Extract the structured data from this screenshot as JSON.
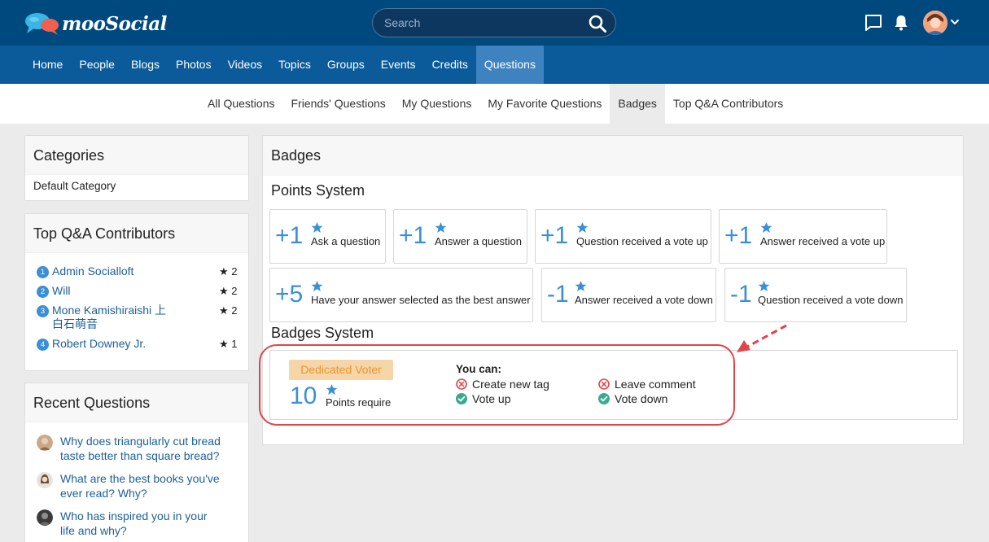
{
  "header": {
    "brand": "mooSocial",
    "search_placeholder": "Search"
  },
  "main_nav": [
    {
      "label": "Home",
      "name": "nav-home"
    },
    {
      "label": "People",
      "name": "nav-people"
    },
    {
      "label": "Blogs",
      "name": "nav-blogs"
    },
    {
      "label": "Photos",
      "name": "nav-photos"
    },
    {
      "label": "Videos",
      "name": "nav-videos"
    },
    {
      "label": "Topics",
      "name": "nav-topics"
    },
    {
      "label": "Groups",
      "name": "nav-groups"
    },
    {
      "label": "Events",
      "name": "nav-events"
    },
    {
      "label": "Credits",
      "name": "nav-credits"
    },
    {
      "label": "Questions",
      "name": "nav-questions",
      "active": true
    }
  ],
  "sub_nav": [
    {
      "label": "All Questions",
      "name": "subnav-all-questions"
    },
    {
      "label": "Friends' Questions",
      "name": "subnav-friends-questions"
    },
    {
      "label": "My Questions",
      "name": "subnav-my-questions"
    },
    {
      "label": "My Favorite Questions",
      "name": "subnav-my-favorite-questions"
    },
    {
      "label": "Badges",
      "name": "subnav-badges",
      "active": true
    },
    {
      "label": "Top Q&A Contributors",
      "name": "subnav-top-contributors"
    }
  ],
  "sidebar": {
    "categories": {
      "title": "Categories",
      "items": [
        "Default Category"
      ]
    },
    "contributors": {
      "title": "Top Q&A Contributors",
      "items": [
        {
          "rank": "1",
          "name": "Admin Socialloft",
          "points": "2"
        },
        {
          "rank": "2",
          "name": "Will",
          "points": "2"
        },
        {
          "rank": "3",
          "name": "Mone Kamishiraishi 上白石萌音",
          "points": "2"
        },
        {
          "rank": "4",
          "name": "Robert Downey Jr.",
          "points": "1"
        }
      ]
    },
    "recent": {
      "title": "Recent Questions",
      "items": [
        "Why does triangularly cut bread taste better than square bread?",
        "What are the best books you've ever read? Why?",
        "Who has inspired you in your life and why?"
      ]
    }
  },
  "main": {
    "title": "Badges",
    "points_system": {
      "title": "Points System",
      "rows": [
        [
          {
            "value": "+1",
            "label": "Ask a question"
          },
          {
            "value": "+1",
            "label": "Answer a question"
          },
          {
            "value": "+1",
            "label": "Question received a vote up"
          },
          {
            "value": "+1",
            "label": "Answer received a vote up"
          }
        ],
        [
          {
            "value": "+5",
            "label": "Have your answer selected as the best answer"
          },
          {
            "value": "-1",
            "label": "Answer received a vote down"
          },
          {
            "value": "-1",
            "label": "Question received a vote down"
          }
        ]
      ]
    },
    "badges_system": {
      "title": "Badges System",
      "badge": {
        "name": "Dedicated Voter",
        "points": "10",
        "points_label": "Points require",
        "you_can_label": "You can:",
        "permissions": [
          {
            "label": "Create new tag",
            "allowed": false
          },
          {
            "label": "Leave comment",
            "allowed": false
          },
          {
            "label": "Vote up",
            "allowed": true
          },
          {
            "label": "Vote down",
            "allowed": true
          }
        ]
      }
    }
  },
  "colors": {
    "header_bg": "#00497f",
    "nav_bg": "#0b5a9a",
    "nav_active": "#3e82c0",
    "accent_blue": "#3b8fd6",
    "badge_bg": "#f6d5a9",
    "badge_text": "#e8952e",
    "allowed": "#3aaa8f",
    "denied": "#e0454b",
    "highlight": "#e0454b"
  }
}
